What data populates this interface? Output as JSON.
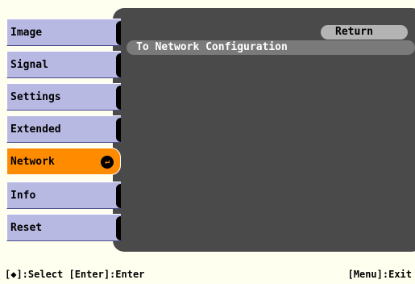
{
  "sidebar": {
    "items": [
      {
        "label": "Image"
      },
      {
        "label": "Signal"
      },
      {
        "label": "Settings"
      },
      {
        "label": "Extended"
      },
      {
        "label": "Network"
      },
      {
        "label": "Info"
      },
      {
        "label": "Reset"
      }
    ],
    "active_index": 4,
    "enter_icon": "enter-icon"
  },
  "main": {
    "return_label": "Return",
    "config_item_label": "To Network Configuration"
  },
  "footer": {
    "left": "[◆]:Select [Enter]:Enter",
    "right": "[Menu]:Exit"
  },
  "colors": {
    "background": "#fffff0",
    "panel": "#4a4a4a",
    "menu_item": "#b7b9e3",
    "menu_active": "#ff8c00",
    "return_button": "#b4b4b4",
    "config_item": "#7a7a7a"
  }
}
